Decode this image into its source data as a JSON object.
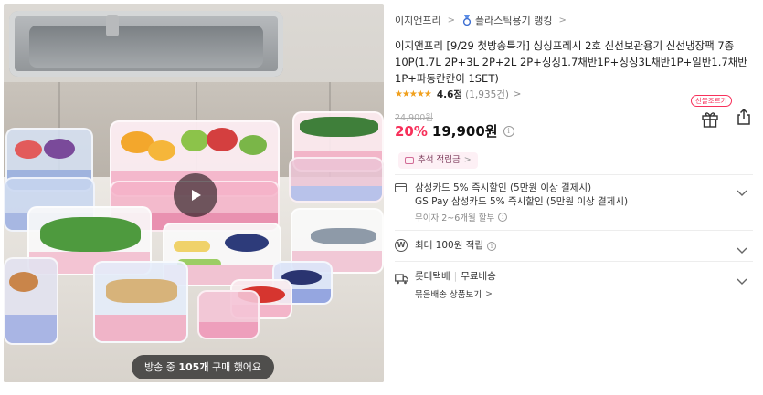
{
  "media": {
    "live_prefix": "방송 중",
    "live_count": "105개",
    "live_suffix": "구매 했어요",
    "play_icon": "play-icon"
  },
  "breadcrumb": {
    "store": "이지앤프리",
    "ranking": "플라스틱용기 랭킹"
  },
  "product": {
    "title": "이지앤프리 [9/29 첫방송특가] 싱싱프레시 2호 신선보관용기 신선냉장팩 7종 10P(1.7L 2P+3L 2P+2L 2P+싱싱1.7채반1P+싱싱3L채반1P+일반1.7채반1P+파동칸칸이 1SET)",
    "rating_stars": 4.6,
    "rating_score": "4.6점",
    "review_count": "(1,935건)",
    "original_price": "24,900원",
    "discount": "20%",
    "price": "19,900원"
  },
  "actions": {
    "gift_badge": "선물조르기",
    "gift_icon": "gift-icon",
    "share_icon": "share-icon"
  },
  "chuseok_chip": {
    "label": "추석 적립금"
  },
  "benefits": {
    "card": {
      "line1": "삼성카드 5% 즉시할인 (5만원 이상 결제시)",
      "line2": "GS Pay 삼성카드 5% 즉시할인 (5만원 이상 결제시)",
      "installment": "무이자 2~6개월 할부"
    },
    "points": {
      "label": "최대 100원 적립"
    },
    "delivery": {
      "carrier": "롯데택배",
      "fee": "무료배송",
      "bundle_link": "묶음배송 상품보기"
    }
  },
  "colors": {
    "discount": "#f7315b",
    "star": "#f0a01e",
    "chip_bg": "#fdf0f5"
  }
}
